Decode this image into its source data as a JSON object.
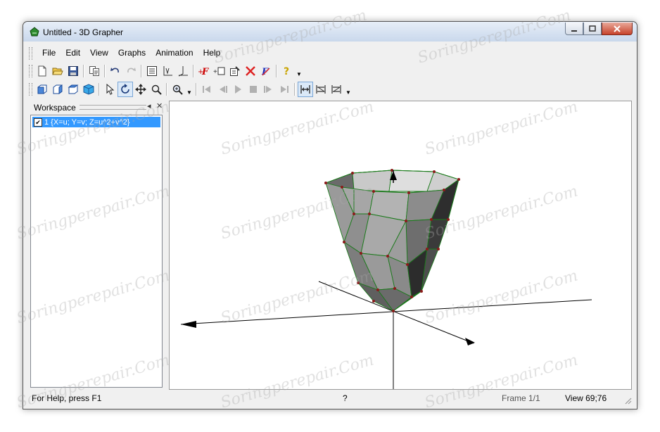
{
  "window": {
    "title": "Untitled - 3D Grapher",
    "controls": {
      "minimize": "minimize",
      "maximize": "maximize",
      "close": "close"
    }
  },
  "menu": [
    "File",
    "Edit",
    "View",
    "Graphs",
    "Animation",
    "Help"
  ],
  "toolbar1": {
    "icons": [
      "new-file-icon",
      "open-folder-icon",
      "save-icon",
      "copy-icon",
      "undo-icon",
      "redo-icon",
      "properties-icon",
      "axes-icon",
      "axes-origin-icon",
      "add-function-icon",
      "add-object-icon",
      "edit-graph-icon",
      "delete-graph-icon",
      "function-style-icon",
      "help-icon"
    ]
  },
  "toolbar2": {
    "icons": [
      "view-front-icon",
      "view-side-icon",
      "view-top-icon",
      "view-3d-icon",
      "select-pointer-icon",
      "rotate-icon",
      "move-icon",
      "zoom-region-icon",
      "zoom-icon",
      "go-first-icon",
      "step-back-icon",
      "play-icon",
      "stop-icon",
      "step-forward-icon",
      "go-last-icon",
      "fit-horizontal-icon",
      "fit-both-icon",
      "fit-fixed-icon"
    ]
  },
  "workspace": {
    "title": "Workspace",
    "items": [
      {
        "label": "1 {X=u; Y=v; Z=u^2+v^2}",
        "checked": true
      }
    ]
  },
  "status": {
    "help": "For Help, press F1",
    "indicator": "?",
    "frame": "Frame 1/1",
    "view": "View 69;76"
  },
  "watermark": "Soringperepair.Com",
  "colors": {
    "selection": "#3399ff",
    "surface_mesh": "#1a7a1a",
    "vertices": "#8b1a1a"
  }
}
